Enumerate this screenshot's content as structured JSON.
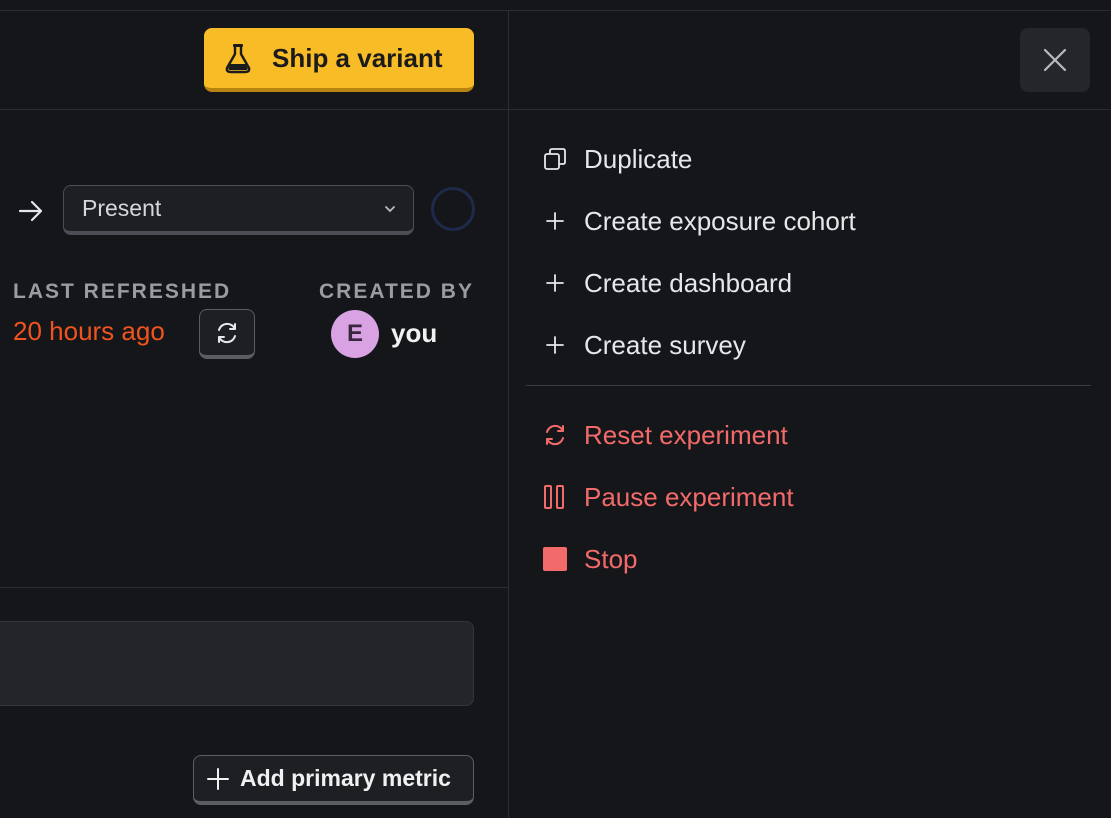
{
  "header": {
    "ship_label": "Ship a variant"
  },
  "date_range": {
    "selected": "Present"
  },
  "info": {
    "last_refreshed_label": "LAST REFRESHED",
    "last_refreshed_value": "20 hours ago",
    "created_by_label": "CREATED BY",
    "created_by_initial": "E",
    "created_by_name": "you"
  },
  "metrics": {
    "add_primary_label": "Add primary metric"
  },
  "menu": {
    "items": [
      {
        "label": "Duplicate",
        "icon": "duplicate-icon"
      },
      {
        "label": "Create exposure cohort",
        "icon": "plus-icon"
      },
      {
        "label": "Create dashboard",
        "icon": "plus-icon"
      },
      {
        "label": "Create survey",
        "icon": "plus-icon"
      }
    ],
    "danger_items": [
      {
        "label": "Reset experiment",
        "icon": "reset-icon"
      },
      {
        "label": "Pause experiment",
        "icon": "pause-icon"
      },
      {
        "label": "Stop",
        "icon": "stop-icon"
      }
    ]
  },
  "colors": {
    "accent": "#f8bc27",
    "danger": "#f36a6a",
    "stale": "#f0541e",
    "avatar": "#d9a3e3"
  }
}
